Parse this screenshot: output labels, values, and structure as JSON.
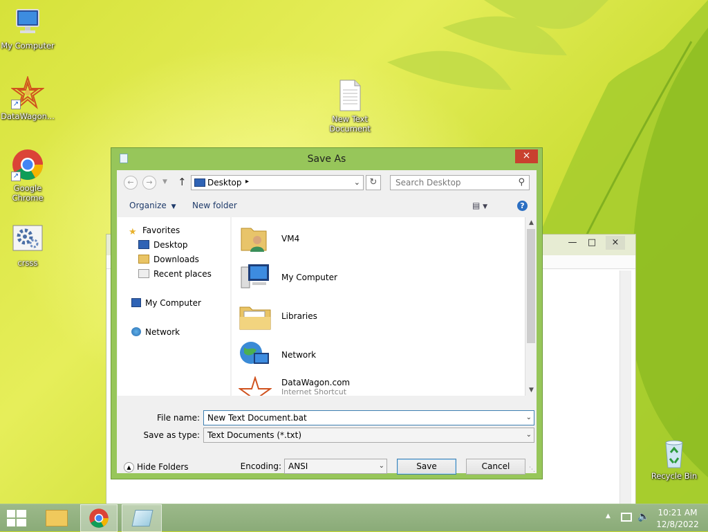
{
  "desktop": {
    "icons": [
      {
        "label": "My Computer"
      },
      {
        "label": "DataWagon..."
      },
      {
        "label": "Google Chrome"
      },
      {
        "label": "crsss"
      },
      {
        "label": "New Text Document"
      },
      {
        "label": "Recycle Bin"
      }
    ]
  },
  "dialog": {
    "title": "Save As",
    "close_icon": "×",
    "address": {
      "location": "Desktop"
    },
    "search": {
      "placeholder": "Search Desktop"
    },
    "toolbar": {
      "organize": "Organize",
      "new_folder": "New folder"
    },
    "nav_pane": {
      "favorites": "Favorites",
      "favorites_items": [
        "Desktop",
        "Downloads",
        "Recent places"
      ],
      "my_computer": "My Computer",
      "network": "Network"
    },
    "files": [
      {
        "name": "VM4",
        "icon": "user-folder-icon"
      },
      {
        "name": "My Computer",
        "icon": "computer-icon"
      },
      {
        "name": "Libraries",
        "icon": "libraries-icon"
      },
      {
        "name": "Network",
        "icon": "network-icon"
      },
      {
        "name": "DataWagon.com",
        "sub": "Internet Shortcut",
        "icon": "internet-shortcut-icon"
      }
    ],
    "form": {
      "file_name_label": "File name:",
      "file_name_value": "New Text Document.bat",
      "save_type_label": "Save as type:",
      "save_type_value": "Text Documents (*.txt)",
      "encoding_label": "Encoding:",
      "encoding_value": "ANSI",
      "hide_folders": "Hide Folders",
      "save": "Save",
      "cancel": "Cancel"
    }
  },
  "taskbar": {
    "time": "10:21 AM",
    "date": "12/8/2022"
  },
  "colors": {
    "dialog_frame": "#97c65a",
    "close_red": "#c9412f",
    "taskbar": "#93b281",
    "accent_blue": "#3c7fb1"
  }
}
